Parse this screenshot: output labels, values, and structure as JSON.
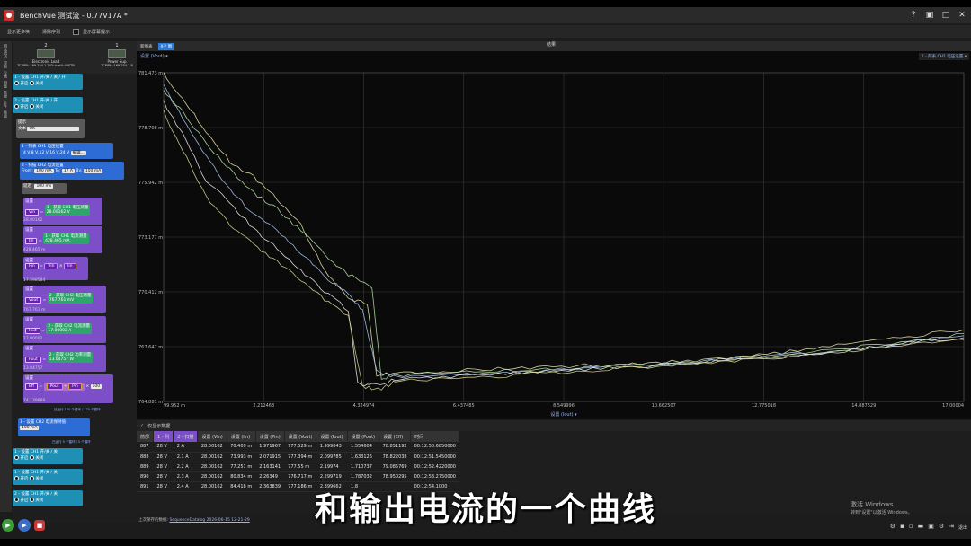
{
  "app": {
    "title": "BenchVue 测试流 - 0.77V17A *",
    "win_icons": [
      "help-icon",
      "restore-icon",
      "maximize-icon",
      "close-icon"
    ]
  },
  "toolbar": {
    "show_parallel": "显示更多块",
    "clear_sequence": "清除序列",
    "show_screen": "显示屏幕提示"
  },
  "sidebar_tabs": [
    "测试流块",
    "控制",
    "仪器",
    "测量",
    "数据",
    "文件",
    "高级"
  ],
  "instruments": [
    {
      "num": "2",
      "name": "Electronic Load",
      "addr": "TCPIP0::169.254.1.243::inst0::INSTR"
    },
    {
      "num": "1",
      "name": "Power Sup",
      "addr": "TCPIP0::169.254.1.8"
    }
  ],
  "blocks": {
    "set_ch1_a": "1 - 设置 CH1 开/关 / 关 / 开",
    "on": "开启",
    "off": "关闭",
    "set_ch2_a": "2 - 设置 CH1 开/关 / 开",
    "prompt_title": "提示",
    "text_label": "文本",
    "text_value": "OK",
    "list_label": "1 - 列表  CH1 电压设置",
    "list_values": "4 V,8 V,12 V,16 V,24 V",
    "list_edit": "编辑...",
    "loop_label": "2 - 扫描 CH2 电流设置",
    "from_label": "From:",
    "from_val": "100 mA",
    "to_label": "To:",
    "to_val": "17 A",
    "by_label": "By:",
    "by_val": "100 mA",
    "delay_label": "延迟",
    "delay_val": "100 ms",
    "set_label": "设置",
    "vin": "Vin",
    "vin_meas": "1 - 获取 CH1 电压测量",
    "vin_value": "28.00162 V",
    "vin_under": "28.00162",
    "iin": "Iin",
    "iin_meas": "1 - 获取 CH1 电流测量",
    "iin_value": "428.465 mA",
    "iin_under": "428.465 m",
    "pin": "Pin",
    "pin_under": "17.598584",
    "vout": "Vout",
    "vout_meas": "2 - 获取 CH2 电压测量",
    "vout_value": "767.761 mV",
    "vout_under": "767.761 m",
    "iout": "Iout",
    "iout_meas": "2 - 获取 CH2 电流测量",
    "iout_value": "17.00002 A",
    "iout_under": "17.00002",
    "pout": "Pout",
    "pout_meas": "2 - 获取 CH2 功率测量",
    "pout_value": "13.04757 W",
    "pout_under": "13.04757",
    "eff": "Eff",
    "eff_const": "100",
    "eff_under": "74.139889",
    "inner_done": "已运行 170 个循环 / 170 个循环",
    "set_ch2_curr": "1 - 设置 CH2 电流保持值",
    "ch2_curr_val": "100 mA",
    "outer_done": "已运行 5 个循环 / 5 个循环",
    "set_ch1_b": "1 - 设置 CH1 开/关 / 关",
    "set_ch1_c": "1 - 设置 CH1 开/关 / 关",
    "set_ch2_b": "2 - 设置 CH1 开/关 / 关"
  },
  "tabs": {
    "new_chart": "新图表",
    "xy": "X-Y 图",
    "results": "结果"
  },
  "chart": {
    "y_dropdown": "设置 (Vout)",
    "series_dropdown": "1 - 列表  CH1 电压设置",
    "x_dropdown": "设置 (Iout)"
  },
  "chart_data": {
    "type": "line",
    "xlabel": "设置 (Iout)",
    "ylabel": "设置 (Vout)",
    "xlim": [
      0.099952,
      17.00004
    ],
    "ylim": [
      764.881,
      781.473
    ],
    "x_ticks": [
      "99.952 m",
      "2.212463",
      "4.324974",
      "6.437485",
      "8.549996",
      "10.662507",
      "12.775018",
      "14.887529",
      "17.00004"
    ],
    "y_ticks": [
      "781.473 m",
      "778.708 m",
      "775.942 m",
      "773.177 m",
      "770.412 m",
      "767.647 m",
      "764.881 m"
    ],
    "grid": true,
    "series": [
      {
        "color": "#e8e8b0",
        "x": [
          0.1,
          0.5,
          1.0,
          1.5,
          2.0,
          2.5,
          3.0,
          3.5,
          4.0,
          4.4,
          4.6,
          5.0,
          6.0,
          7.0,
          8.0,
          9.0,
          10.0,
          11.0,
          12.0,
          13.0,
          14.0,
          15.0,
          16.0,
          17.0
        ],
        "y": [
          781.4,
          780.2,
          778.5,
          777.0,
          776.2,
          775.1,
          773.8,
          771.5,
          770.1,
          769.8,
          766.2,
          766.3,
          766.4,
          766.5,
          766.6,
          766.7,
          766.8,
          766.9,
          767.1,
          767.3,
          767.6,
          767.9,
          768.2,
          768.5
        ]
      },
      {
        "color": "#b8e6a8",
        "x": [
          0.1,
          0.5,
          1.0,
          1.5,
          2.0,
          2.5,
          3.0,
          3.5,
          4.0,
          4.5,
          4.7,
          5.0,
          6.0,
          7.0,
          8.0,
          9.0,
          10.0,
          11.0,
          12.0,
          13.0,
          14.0,
          15.0,
          16.0,
          17.0
        ],
        "y": [
          780.5,
          779.5,
          777.9,
          776.6,
          775.4,
          774.6,
          773.5,
          772.3,
          771.3,
          770.6,
          766.0,
          766.2,
          766.3,
          766.4,
          766.5,
          766.6,
          766.7,
          766.8,
          767.0,
          767.2,
          767.4,
          767.7,
          768.0,
          768.3
        ]
      },
      {
        "color": "#a8c8f0",
        "x": [
          0.1,
          0.5,
          1.0,
          1.5,
          2.0,
          2.5,
          3.0,
          3.5,
          4.0,
          4.3,
          4.6,
          5.0,
          6.0,
          7.0,
          8.0,
          9.0,
          10.0,
          11.0,
          12.0,
          13.0,
          14.0,
          15.0,
          16.0,
          17.0
        ],
        "y": [
          780.8,
          779.2,
          777.2,
          775.6,
          774.3,
          773.5,
          772.4,
          771.2,
          770.3,
          769.5,
          766.4,
          766.1,
          766.2,
          766.3,
          766.4,
          766.6,
          766.7,
          766.8,
          767.0,
          767.2,
          767.4,
          767.6,
          767.9,
          768.2
        ]
      },
      {
        "color": "#f0f0f0",
        "x": [
          0.1,
          0.5,
          1.0,
          1.5,
          2.0,
          2.5,
          3.0,
          3.5,
          4.0,
          4.2,
          4.5,
          5.0,
          6.0,
          7.0,
          8.0,
          9.0,
          10.0,
          11.0,
          12.0,
          13.0,
          14.0,
          15.0,
          16.0,
          17.0
        ],
        "y": [
          780.0,
          778.4,
          776.0,
          774.9,
          773.6,
          772.6,
          771.5,
          770.4,
          769.5,
          765.8,
          765.7,
          766.0,
          766.1,
          766.2,
          766.4,
          766.5,
          766.6,
          766.8,
          767.0,
          767.1,
          767.3,
          767.6,
          767.9,
          768.1
        ]
      },
      {
        "color": "#d8d890",
        "x": [
          0.1,
          0.5,
          1.0,
          1.5,
          2.0,
          2.5,
          3.0,
          3.5,
          4.0,
          4.3,
          4.7,
          5.0,
          6.0,
          7.0,
          8.0,
          9.0,
          10.0,
          11.0,
          12.0,
          13.0,
          14.0,
          15.0,
          16.0,
          17.0
        ],
        "y": [
          779.5,
          777.6,
          775.2,
          773.8,
          772.8,
          771.9,
          771.0,
          770.0,
          769.2,
          765.6,
          765.5,
          765.9,
          766.0,
          766.1,
          766.3,
          766.4,
          766.6,
          766.7,
          766.9,
          767.1,
          767.3,
          767.5,
          767.8,
          768.0
        ]
      }
    ]
  },
  "table": {
    "toggle_label": "仅显示数据",
    "headers": [
      "前部",
      "1 - 列",
      "2 - 扫描",
      "设置 (Vin)",
      "设置 (Iin)",
      "设置 (Pin)",
      "设置 (Vout)",
      "设置 (Iout)",
      "设置 (Pout)",
      "设置 (Eff)",
      "时间"
    ],
    "rows": [
      [
        "887",
        "28 V",
        "2 A",
        "28.00162",
        "70.409 m",
        "1.971967",
        "777.529 m",
        "1.999843",
        "1.554604",
        "78.851192",
        "00:12:50.6850000"
      ],
      [
        "888",
        "28 V",
        "2.1 A",
        "28.00162",
        "73.993 m",
        "2.071915",
        "777.394 m",
        "2.099785",
        "1.633126",
        "78.822038",
        "00:12:51.5450000"
      ],
      [
        "889",
        "28 V",
        "2.2 A",
        "28.00162",
        "77.251 m",
        "2.163141",
        "777.55 m",
        "2.19974",
        "1.710737",
        "79.085769",
        "00:12:52.4220000"
      ],
      [
        "890",
        "28 V",
        "2.3 A",
        "28.00162",
        "80.834 m",
        "2.26349",
        "776.717 m",
        "2.299719",
        "1.787032",
        "78.950295",
        "00:12:53.2750000"
      ],
      [
        "891",
        "28 V",
        "2.4 A",
        "28.00162",
        "84.418 m",
        "2.363839",
        "777.186 m",
        "2.399662",
        "1.8",
        "",
        "00:12:54.1000"
      ]
    ]
  },
  "status": {
    "prefix": "上次保存的数据:",
    "link": "SequenceDatalog 2026-06-15 12-21-29"
  },
  "watermark": {
    "line1": "激活 Windows",
    "line2": "转到\"设置\"以激活 Windows。"
  },
  "subtitle": "和输出电流的一个曲线",
  "controls": {
    "run_icon": "play-icon",
    "step_icon": "step-icon",
    "stop_icon": "stop-icon"
  },
  "bottom_icons": [
    "gear-icon",
    "save-icon",
    "save-as-icon",
    "folder-icon",
    "export-icon",
    "settings-icon",
    "exit-icon"
  ],
  "exit_label": "退出"
}
